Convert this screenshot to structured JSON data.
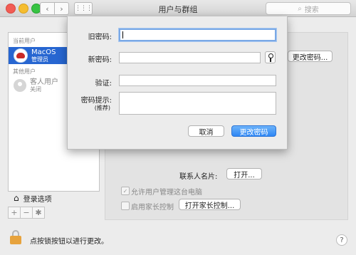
{
  "window": {
    "title": "用户与群组",
    "search_placeholder": "搜索"
  },
  "sidebar": {
    "current_users_label": "当前用户",
    "current_user": {
      "name": "MacOS",
      "role": "管理员"
    },
    "other_users_label": "其他用户",
    "guest_user": {
      "name": "客人用户",
      "status": "关闭"
    },
    "login_options_label": "登录选项",
    "add_label": "+",
    "remove_label": "−",
    "gear_label": "✱"
  },
  "main": {
    "change_password_button": "更改密码...",
    "contact_card_label": "联系人名片:",
    "open_button": "打开...",
    "allow_admin_label": "允许用户管理这台电脑",
    "parental_controls_label": "启用家长控制",
    "open_parental_button": "打开家长控制..."
  },
  "sheet": {
    "old_password_label": "旧密码:",
    "new_password_label": "新密码:",
    "verify_label": "验证:",
    "hint_label": "密码提示:",
    "hint_sub_label": "(推荐)",
    "cancel_button": "取消",
    "confirm_button": "更改密码"
  },
  "footer": {
    "lock_text": "点按锁按钮以进行更改。",
    "help_label": "?"
  },
  "states": {
    "allow_admin_checked": true,
    "parental_controls_checked": false
  },
  "colors": {
    "selection": "#2766d1",
    "primary_button": "#2e86f4",
    "lock": "#e7a33d"
  }
}
